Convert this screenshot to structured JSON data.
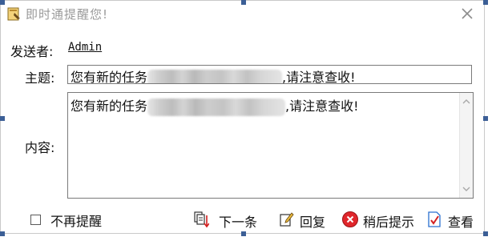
{
  "window": {
    "title": "即时通提醒您!",
    "close_icon": "close-icon",
    "app_icon": "app-notification-icon"
  },
  "form": {
    "sender_label": "发送者:",
    "sender_value": "Admin",
    "subject_label": "主题:",
    "subject_prefix": "您有新的任务",
    "subject_suffix": ",请注意查收!",
    "content_label": "内容:",
    "content_prefix": "您有新的任务",
    "content_suffix": ",请注意查收!"
  },
  "footer": {
    "no_remind_label": "不再提醒",
    "no_remind_checked": false,
    "next_label": "下一条",
    "reply_label": "回复",
    "later_label": "稍后提示",
    "view_label": "查看"
  },
  "colors": {
    "selection_handle": "#3c5f96",
    "later_icon": "#e0262b",
    "view_icon": "#2a6fd0"
  }
}
